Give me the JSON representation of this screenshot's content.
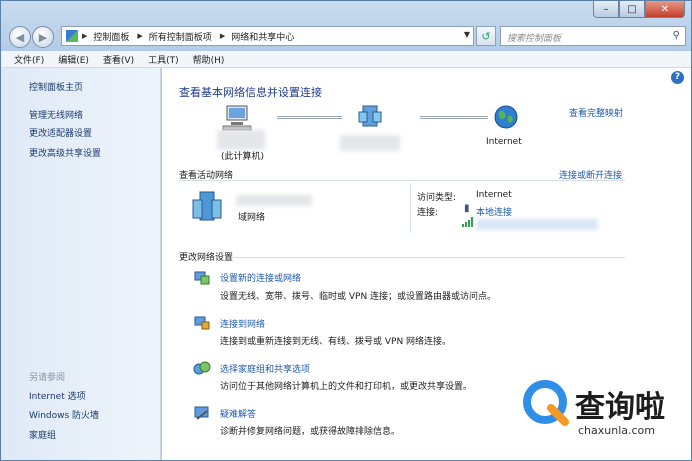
{
  "address": {
    "segments": [
      "控制面板",
      "所有控制面板项",
      "网络和共享中心"
    ],
    "search_placeholder": "搜索控制面板"
  },
  "menu": [
    "文件(F)",
    "编辑(E)",
    "查看(V)",
    "工具(T)",
    "帮助(H)"
  ],
  "sidebar": {
    "home": "控制面板主页",
    "links": [
      "管理无线网络",
      "更改适配器设置",
      "更改高级共享设置"
    ],
    "see_also_title": "另请参阅",
    "see_also": [
      "Internet 选项",
      "Windows 防火墙",
      "家庭组"
    ]
  },
  "main": {
    "heading": "查看基本网络信息并设置连接",
    "full_map": "查看完整映射",
    "this_computer": "(此计算机)",
    "internet_label": "Internet",
    "active_title": "查看活动网络",
    "connect_disconnect": "连接或断开连接",
    "network_type": "域网络",
    "access_type_label": "访问类型:",
    "access_type_value": "Internet",
    "connection_label": "连接:",
    "connection_value": "本地连接",
    "change_title": "更改网络设置",
    "tasks": [
      {
        "title": "设置新的连接或网络",
        "desc": "设置无线、宽带、拨号、临时或 VPN 连接；或设置路由器或访问点。"
      },
      {
        "title": "连接到网络",
        "desc": "连接到或重新连接到无线、有线、拨号或 VPN 网络连接。"
      },
      {
        "title": "选择家庭组和共享选项",
        "desc": "访问位于其他网络计算机上的文件和打印机，或更改共享设置。"
      },
      {
        "title": "疑难解答",
        "desc": "诊断并修复网络问题，或获得故障排除信息。"
      }
    ]
  },
  "watermark": {
    "brand": "查询啦",
    "url": "chaxunla.com"
  }
}
